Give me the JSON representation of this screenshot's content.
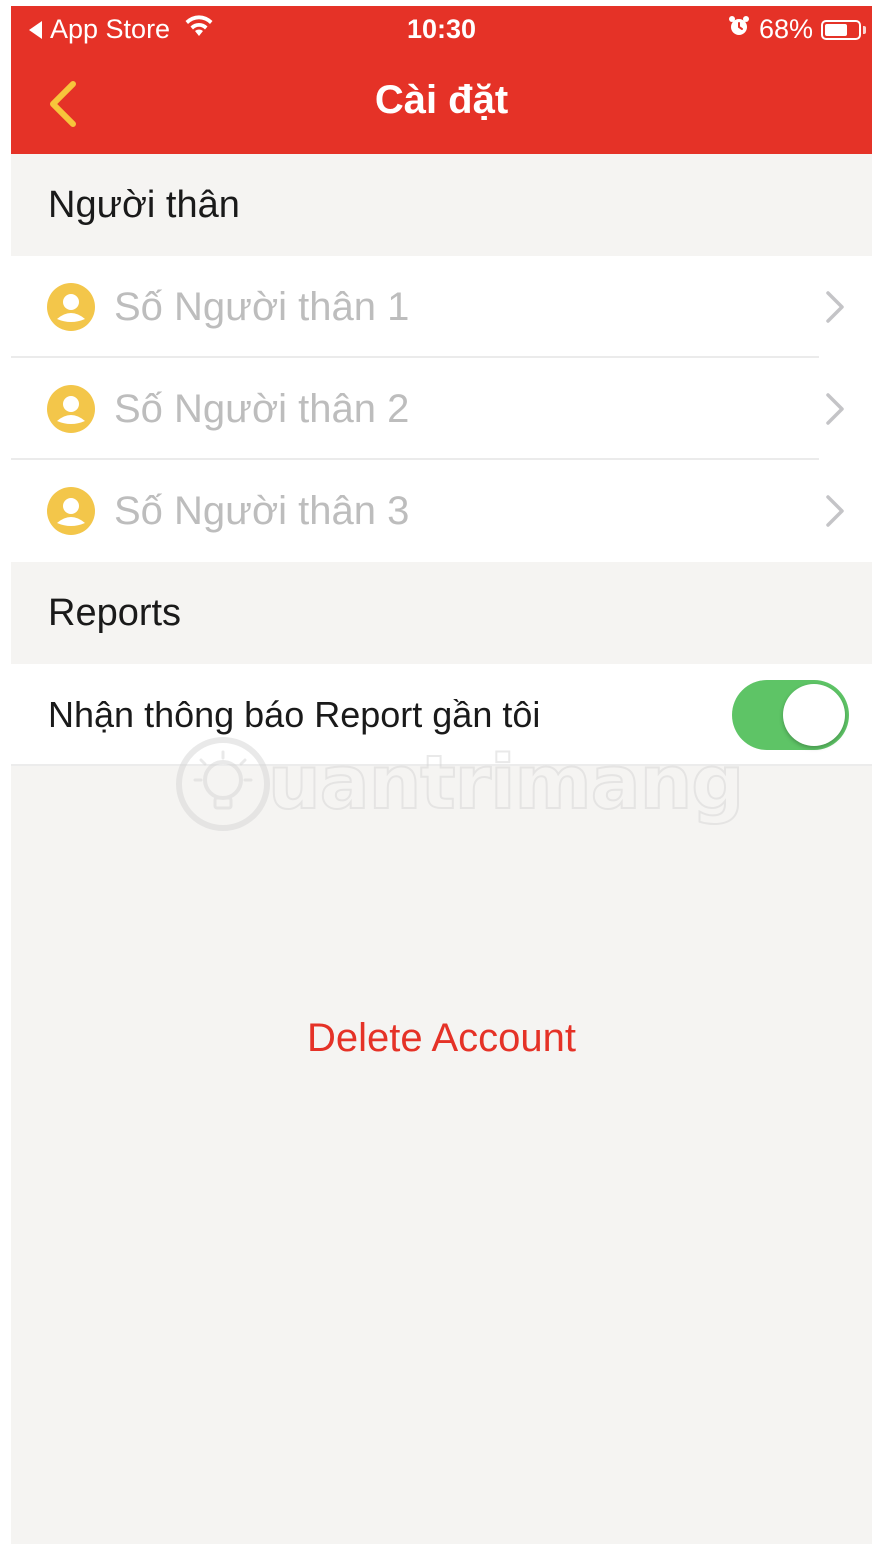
{
  "status_bar": {
    "back_app": "App Store",
    "time": "10:30",
    "battery": "68%",
    "battery_level": 0.68
  },
  "nav": {
    "title": "Cài đặt",
    "back_icon": "chevron-left-icon"
  },
  "sections": {
    "relatives_header": "Người thân",
    "reports_header": "Reports"
  },
  "relatives": [
    {
      "label": "Số Người thân 1",
      "icon": "person-icon"
    },
    {
      "label": "Số Người thân 2",
      "icon": "person-icon"
    },
    {
      "label": "Số Người thân 3",
      "icon": "person-icon"
    }
  ],
  "reports": {
    "toggle_label": "Nhận thông báo Report gần tôi",
    "toggle_on": true
  },
  "delete_account": "Delete Account",
  "watermark": "uantrimang",
  "colors": {
    "header_bg": "#e53227",
    "back_chevron": "#f7c53b",
    "person_icon": "#f3c64a",
    "toggle_on": "#5ec466",
    "delete_text": "#e53227"
  }
}
